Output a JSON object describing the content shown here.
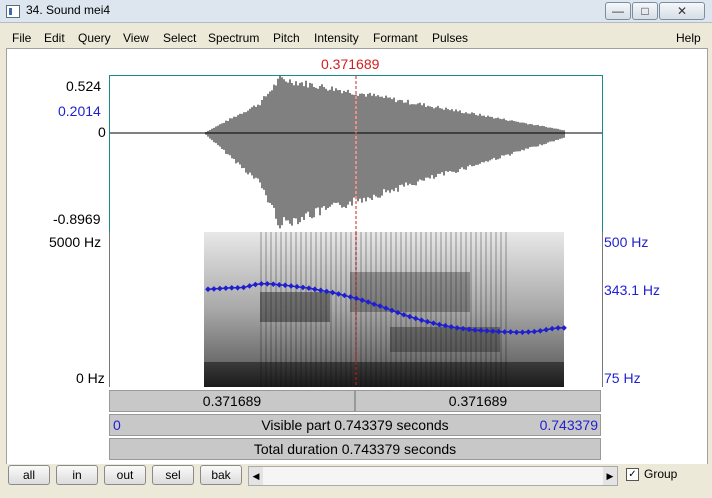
{
  "window": {
    "title": "34. Sound mei4",
    "min": "—",
    "max": "□",
    "close": "✕"
  },
  "menu": [
    "File",
    "Edit",
    "Query",
    "View",
    "Select",
    "Spectrum",
    "Pitch",
    "Intensity",
    "Formant",
    "Pulses"
  ],
  "menu_help": "Help",
  "cursor_time": "0.371689",
  "waveform": {
    "ymax": "0.524",
    "cursor_value": "0.2014",
    "zero": "0",
    "ymin": "-0.8969"
  },
  "spectrogram": {
    "freq_top": "5000 Hz",
    "freq_bottom": "0 Hz"
  },
  "pitch": {
    "top": "500 Hz",
    "current": "343.1 Hz",
    "bottom": "75 Hz"
  },
  "bars": {
    "left_time": "0.371689",
    "right_time": "0.371689",
    "visible_start": "0",
    "visible_label": "Visible part 0.743379 seconds",
    "visible_end": "0.743379",
    "total_label": "Total duration 0.743379 seconds"
  },
  "buttons": [
    "all",
    "in",
    "out",
    "sel",
    "bak"
  ],
  "group": {
    "label": "Group",
    "checked": "✓"
  },
  "colors": {
    "pitch": "#1f1fd0",
    "cursor": "#d01f1f",
    "wave_border": "#1a8a8a"
  },
  "pitch_track_hz": [
    343,
    344,
    345,
    346,
    347,
    347,
    348,
    352,
    356,
    358,
    358,
    357,
    355,
    354,
    352,
    350,
    348,
    346,
    343,
    340,
    337,
    334,
    330,
    326,
    322,
    318,
    313,
    308,
    302,
    297,
    291,
    285,
    279,
    273,
    268,
    263,
    258,
    254,
    250,
    246,
    243,
    240,
    237,
    235,
    233,
    231,
    230,
    229,
    228,
    227,
    226,
    226,
    225,
    225,
    226,
    227,
    229,
    232,
    235,
    237,
    237
  ],
  "pitch_range_hz": [
    75,
    500
  ]
}
